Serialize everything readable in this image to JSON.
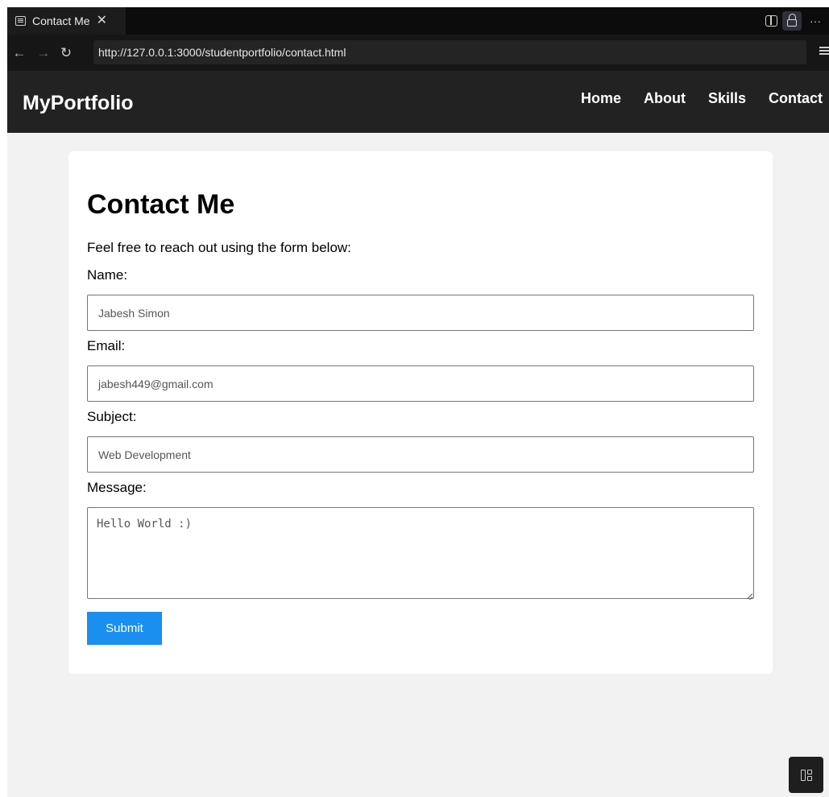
{
  "browser": {
    "tab_title": "Contact Me",
    "tab_close": "✕",
    "url": "http://127.0.0.1:3000/studentportfolio/contact.html",
    "back": "←",
    "forward": "→",
    "reload": "↻",
    "more": "···"
  },
  "site": {
    "brand": "MyPortfolio",
    "nav": [
      {
        "label": "Home"
      },
      {
        "label": "About"
      },
      {
        "label": "Skills"
      },
      {
        "label": "Contact"
      }
    ]
  },
  "contact": {
    "title": "Contact Me",
    "intro": "Feel free to reach out using the form below:",
    "name_label": "Name:",
    "name_value": "Jabesh Simon",
    "email_label": "Email:",
    "email_value": "jabesh449@gmail.com",
    "subject_label": "Subject:",
    "subject_value": "Web Development",
    "message_label": "Message:",
    "message_value": "Hello World :)",
    "submit_label": "Submit"
  },
  "colors": {
    "header_bg": "#222222",
    "page_bg": "#f2f2f2",
    "accent": "#1a8ff0"
  }
}
